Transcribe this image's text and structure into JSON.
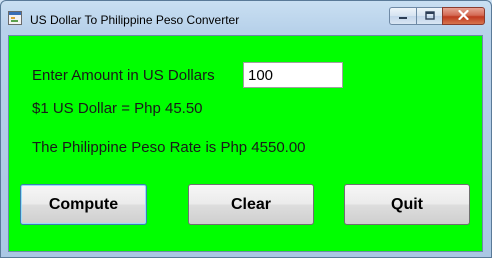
{
  "window": {
    "title": "US Dollar To Philippine Peso Converter"
  },
  "form": {
    "amount_label": "Enter Amount in US Dollars",
    "amount_value": "100",
    "rate_text": "$1 US Dollar =  Php 45.50",
    "result_text": "The Philippine Peso Rate is Php 4550.00"
  },
  "buttons": {
    "compute": "Compute",
    "clear": "Clear",
    "quit": "Quit"
  },
  "colors": {
    "client_background": "#00ff00",
    "close_button": "#c0391f"
  }
}
